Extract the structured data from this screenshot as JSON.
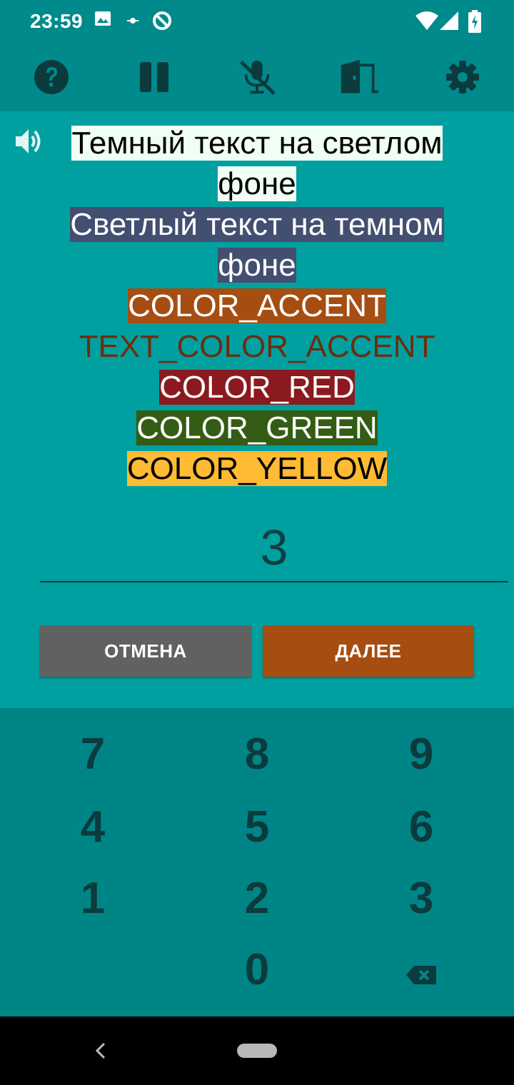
{
  "status_bar": {
    "time": "23:59"
  },
  "toolbar": {
    "icons": [
      "help-icon",
      "pause-icon",
      "mic-off-icon",
      "exit-door-icon",
      "settings-icon"
    ]
  },
  "main": {
    "lines": [
      {
        "text": "Темный текст на светлом фоне",
        "bg": "#f0fff4",
        "color": "#000000"
      },
      {
        "text": "Светлый текст на темном фоне",
        "bg": "#434f70",
        "color": "#ffffff"
      },
      {
        "text": "COLOR_ACCENT",
        "bg": "#a64d12",
        "color": "#ffffff"
      },
      {
        "text": "TEXT_COLOR_ACCENT",
        "bg": "",
        "color": "#6b2e0e"
      },
      {
        "text": "COLOR_RED",
        "bg": "#8a1a1f",
        "color": "#ffffff"
      },
      {
        "text": "COLOR_GREEN",
        "bg": "#345c14",
        "color": "#ffffff"
      },
      {
        "text": "COLOR_YELLOW",
        "bg": "#ffbb33",
        "color": "#000000"
      }
    ],
    "number_value": "3",
    "cancel_label": "ОТМЕНА",
    "next_label": "ДАЛЕЕ",
    "cancel_color": "#616161",
    "next_color": "#a64d12"
  },
  "keypad": {
    "keys": [
      "7",
      "8",
      "9",
      "4",
      "5",
      "6",
      "1",
      "2",
      "3",
      "0"
    ]
  },
  "colors": {
    "header_bg": "#008a8b",
    "content_bg": "#00a0a1",
    "keypad_bg": "#008587"
  }
}
